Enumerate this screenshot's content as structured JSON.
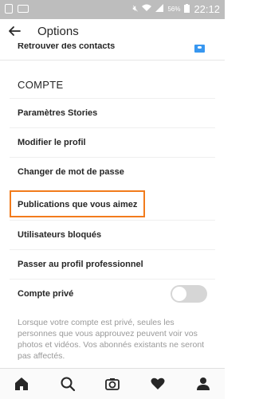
{
  "status_bar": {
    "battery_percent": "56%",
    "time": "22:12"
  },
  "header": {
    "title": "Options"
  },
  "partial_row": {
    "label": "Retrouver des contacts",
    "icon": "contacts-icon"
  },
  "section": {
    "title": "COMPTE"
  },
  "menu": {
    "items": [
      {
        "label": "Paramètres Stories"
      },
      {
        "label": "Modifier le profil"
      },
      {
        "label": "Changer de mot de passe"
      },
      {
        "label": "Publications que vous aimez"
      },
      {
        "label": "Utilisateurs bloqués"
      },
      {
        "label": "Passer au profil professionnel"
      },
      {
        "label": "Compte privé"
      }
    ]
  },
  "private_toggle": {
    "on": false
  },
  "help_text": "Lorsque votre compte est privé, seules les personnes que vous approuvez peuvent voir vos photos et vidéos. Vos abonnés existants ne seront pas affectés.",
  "bottom_nav": {
    "icons": [
      "home-icon",
      "search-icon",
      "camera-icon",
      "heart-icon",
      "profile-icon"
    ]
  },
  "colors": {
    "highlight": "#f27b1c",
    "status_bar": "#bdbdbd",
    "text": "#262626",
    "muted": "#999999"
  }
}
